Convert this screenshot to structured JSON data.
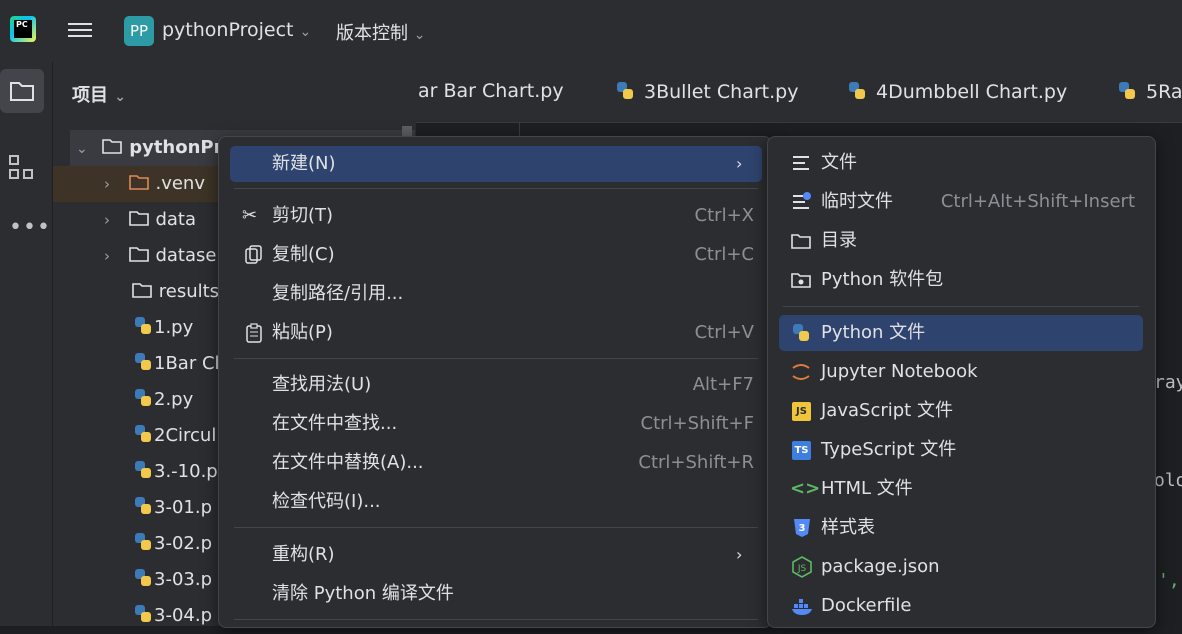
{
  "header": {
    "logo_text": "PC",
    "project_badge": "PP",
    "project_name": "pythonProject",
    "vcs_label": "版本控制"
  },
  "project_panel": {
    "title": "项目",
    "tree": [
      {
        "label": "pythonPr",
        "kind": "folder",
        "expanded": true,
        "bold": true
      },
      {
        "label": ".venv",
        "kind": "folder-excluded"
      },
      {
        "label": "data",
        "kind": "folder"
      },
      {
        "label": "datase",
        "kind": "folder"
      },
      {
        "label": "results",
        "kind": "folder"
      },
      {
        "label": "1.py",
        "kind": "python"
      },
      {
        "label": "1Bar Cl",
        "kind": "python"
      },
      {
        "label": "2.py",
        "kind": "python"
      },
      {
        "label": "2Circul",
        "kind": "python"
      },
      {
        "label": "3.-10.p",
        "kind": "python"
      },
      {
        "label": "3-01.p",
        "kind": "python"
      },
      {
        "label": "3-02.p",
        "kind": "python"
      },
      {
        "label": "3-03.p",
        "kind": "python"
      },
      {
        "label": "3-04.p",
        "kind": "python"
      }
    ]
  },
  "editor": {
    "tabs": [
      {
        "label": "ar Bar Chart.py"
      },
      {
        "label": "3Bullet Chart.py"
      },
      {
        "label": "4Dumbbell Chart.py"
      },
      {
        "label": "5Ra"
      }
    ],
    "code_fragments": [
      "ray",
      "olo",
      "',"
    ]
  },
  "context_menu": {
    "items": [
      {
        "label": "新建(N)",
        "shortcut": "",
        "submenu": true,
        "selected": true
      },
      {
        "label": "剪切(T)",
        "shortcut": "Ctrl+X",
        "icon": "scissors-icon"
      },
      {
        "label": "复制(C)",
        "shortcut": "Ctrl+C",
        "icon": "copy-icon"
      },
      {
        "label": "复制路径/引用...",
        "shortcut": ""
      },
      {
        "label": "粘贴(P)",
        "shortcut": "Ctrl+V",
        "icon": "paste-icon"
      },
      {
        "label": "查找用法(U)",
        "shortcut": "Alt+F7"
      },
      {
        "label": "在文件中查找...",
        "shortcut": "Ctrl+Shift+F"
      },
      {
        "label": "在文件中替换(A)...",
        "shortcut": "Ctrl+Shift+R"
      },
      {
        "label": "检查代码(I)...",
        "shortcut": ""
      },
      {
        "label": "重构(R)",
        "shortcut": "",
        "submenu": true
      },
      {
        "label": "清除 Python 编译文件",
        "shortcut": ""
      }
    ]
  },
  "new_submenu": {
    "items": [
      {
        "label": "文件",
        "icon": "text-file-icon"
      },
      {
        "label": "临时文件",
        "shortcut": "Ctrl+Alt+Shift+Insert",
        "icon": "scratch-file-icon"
      },
      {
        "label": "目录",
        "icon": "folder-icon"
      },
      {
        "label": "Python 软件包",
        "icon": "package-icon"
      },
      {
        "label": "Python 文件",
        "icon": "python-icon",
        "selected": true
      },
      {
        "label": "Jupyter Notebook",
        "icon": "jupyter-icon"
      },
      {
        "label": "JavaScript 文件",
        "icon": "js-icon",
        "badge": "JS"
      },
      {
        "label": "TypeScript 文件",
        "icon": "ts-icon",
        "badge": "TS"
      },
      {
        "label": "HTML 文件",
        "icon": "html-icon"
      },
      {
        "label": "样式表",
        "icon": "css-icon"
      },
      {
        "label": "package.json",
        "icon": "nodejs-icon"
      },
      {
        "label": "Dockerfile",
        "icon": "docker-icon"
      }
    ]
  },
  "colors": {
    "background": "#1e1f22",
    "panel": "#2b2d30",
    "selection": "#2e436e",
    "text": "#dfe1e5",
    "shortcut_text": "#8c8f96"
  }
}
